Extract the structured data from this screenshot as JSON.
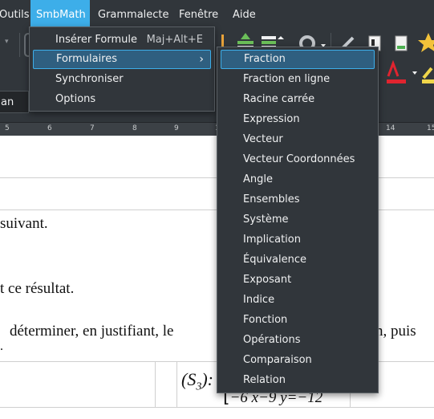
{
  "menubar": {
    "items": [
      {
        "label": "Outils"
      },
      {
        "label": "SmbMath"
      },
      {
        "label": "Grammalecte"
      },
      {
        "label": "Fenêtre"
      },
      {
        "label": "Aide"
      }
    ]
  },
  "toolbar": {
    "font_name_partial": "an"
  },
  "ruler": {
    "ticks": [
      "5",
      "6",
      "7",
      "8",
      "9",
      "1",
      "14",
      "15"
    ]
  },
  "smbmath_menu": {
    "items": [
      {
        "label": "Insérer Formule",
        "shortcut": "Maj+Alt+E"
      },
      {
        "label": "Formulaires"
      },
      {
        "label": "Synchroniser"
      },
      {
        "label": "Options"
      }
    ]
  },
  "formulaires_submenu": {
    "items": [
      "Fraction",
      "Fraction en ligne",
      "Racine carrée",
      "Expression",
      "Vecteur",
      "Vecteur Coordonnées",
      "Angle",
      "Ensembles",
      "Système",
      "Implication",
      "Équivalence",
      "Exposant",
      "Indice",
      "Fonction",
      "Opérations",
      "Comparaison",
      "Relation"
    ]
  },
  "document": {
    "line1": "suivant.",
    "line2": "t ce résultat.",
    "line3_left": "déterminer, en justifiant, le",
    "line3_right": "n, puis",
    "formula_label": "(S",
    "formula_sub": "3",
    "formula_close": "):",
    "formula_eq": "−6 x−9 y=−12"
  },
  "colors": {
    "accent": "#3daee9",
    "menu_bg": "#31363b",
    "font_color_red": "#e0242f"
  }
}
